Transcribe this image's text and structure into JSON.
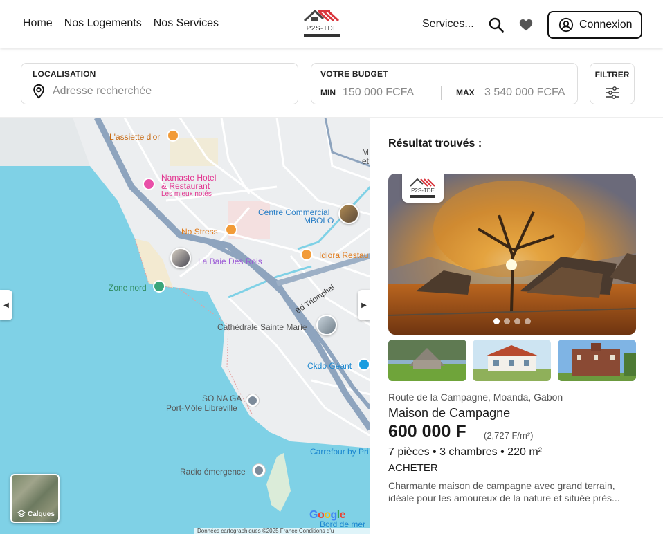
{
  "header": {
    "nav": [
      "Home",
      "Nos Logements",
      "Nos Services"
    ],
    "logo_text": "P2S-TDE",
    "services_label": "Services...",
    "login_label": "Connexion",
    "icons": [
      "search-icon",
      "heart-icon",
      "user-circle-icon"
    ]
  },
  "search": {
    "location_label": "LOCALISATION",
    "location_placeholder": "Adresse recherchée",
    "budget_label": "VOTRE BUDGET",
    "min_label": "MIN",
    "min_placeholder": "150 000 FCFA",
    "max_label": "MAX",
    "max_placeholder": "3 540 000 FCFA",
    "filter_label": "FILTRER"
  },
  "map": {
    "labels": {
      "assiette": "L'assiette d'or",
      "namaste1": "Namaste Hotel",
      "namaste2": "& Restaurant",
      "namaste3": "Les mieux notés",
      "mbolo1": "Centre Commercial",
      "mbolo2": "MBOLO",
      "nostress": "No Stress",
      "idiora": "Idiora Restau",
      "baie": "La Baie Des Rois",
      "zonenord": "Zone nord",
      "triomphal": "Bd Triomphal",
      "cathedrale": "Cathédrale Sainte Marie",
      "ckdo": "Ckdo Géant",
      "sonaga1": "SO NA GA",
      "sonaga2": "Port-Môle Libreville",
      "carrefour": "Carrefour by Pri",
      "radio": "Radio émergence",
      "bord": "Bord de mer",
      "m_et": "M\net",
      "layers": "Calques",
      "google": "Google",
      "footer": "Données cartographiques ©2025    France    Conditions d'u"
    }
  },
  "results": {
    "title": "Résultat trouvés :",
    "photo_logo_text": "P2S-TDE",
    "address": "Route de la Campagne, Moanda, Gabon",
    "name": "Maison de Campagne",
    "price": "600 000 F",
    "price_per_m2": "(2,727 F/m²)",
    "specs": "7 pièces • 3 chambres • 220 m²",
    "transaction": "ACHETER",
    "description": "Charmante maison de campagne avec grand terrain, idéale pour les amoureux de la nature et située près...",
    "carousel_total": 4,
    "carousel_active": 1
  },
  "colors": {
    "water": "#7fd1e6",
    "land": "#eceef0",
    "road": "#8ea4be",
    "accent_red": "#d9343b"
  }
}
